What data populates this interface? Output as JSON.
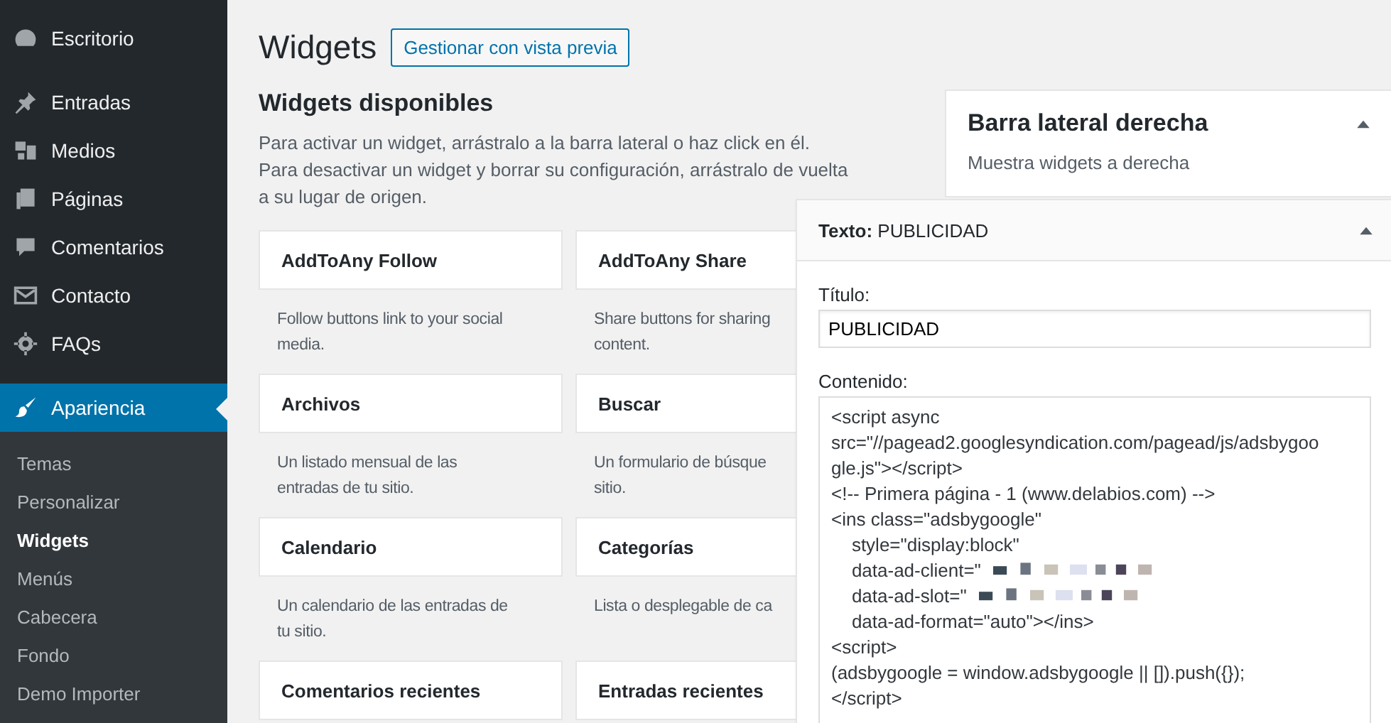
{
  "sidebar": {
    "items": [
      {
        "label": "Escritorio",
        "selected": false
      },
      {
        "label": "Entradas",
        "selected": false
      },
      {
        "label": "Medios",
        "selected": false
      },
      {
        "label": "Páginas",
        "selected": false
      },
      {
        "label": "Comentarios",
        "selected": false
      },
      {
        "label": "Contacto",
        "selected": false
      },
      {
        "label": "FAQs",
        "selected": false
      },
      {
        "label": "Apariencia",
        "selected": true
      }
    ],
    "submenu": [
      {
        "label": "Temas",
        "selected": false
      },
      {
        "label": "Personalizar",
        "selected": false
      },
      {
        "label": "Widgets",
        "selected": true
      },
      {
        "label": "Menús",
        "selected": false
      },
      {
        "label": "Cabecera",
        "selected": false
      },
      {
        "label": "Fondo",
        "selected": false
      },
      {
        "label": "Demo Importer",
        "selected": false
      }
    ]
  },
  "page": {
    "title": "Widgets",
    "button": "Gestionar con vista previa"
  },
  "available": {
    "title": "Widgets disponibles",
    "description": "Para activar un widget, arrástralo a la barra lateral o haz click en él. Para desactivar un widget y borrar su configuración, arrástralo de vuelta a su lugar de origen.",
    "widgets": [
      {
        "title": "AddToAny Follow",
        "description": "Follow buttons link to your social\nmedia."
      },
      {
        "title": "AddToAny Share",
        "description": "Share buttons for sharing\ncontent."
      },
      {
        "title": "Archivos",
        "description": "Un listado mensual de las\nentradas de tu sitio."
      },
      {
        "title": "Buscar",
        "description": "Un formulario de búsque\nsitio."
      },
      {
        "title": "Calendario",
        "description": "Un calendario de las entradas de\ntu sitio."
      },
      {
        "title": "Categorías",
        "description": "Lista o desplegable de ca"
      },
      {
        "title": "Comentarios recientes"
      },
      {
        "title": "Entradas recientes"
      }
    ]
  },
  "sidebar_area": {
    "title": "Barra lateral derecha",
    "description": "Muestra widgets a derecha",
    "expanded": true
  },
  "widget_panel": {
    "title": "**Texto:** PUBLICIDAD",
    "expanded": true,
    "title_label": "Título:",
    "title_value": "PUBLICIDAD",
    "content_label": "Contenido:",
    "content_lines": [
      {
        "text": "<script async",
        "redacted": false
      },
      {
        "text": "src=\"//pagead2.googlesyndication.com/pagead/js/adsbygoo",
        "redacted": false
      },
      {
        "text": "gle.js\"></script>",
        "redacted": false
      },
      {
        "text": "<!-- Primera página - 1 (www.delabios.com) -->",
        "redacted": false
      },
      {
        "text": "<ins class=\"adsbygoogle\"",
        "redacted": false
      },
      {
        "text": "    style=\"display:block\"",
        "redacted": false
      },
      {
        "text": "    data-ad-client=\"",
        "redacted": true
      },
      {
        "text": "    data-ad-slot=\"",
        "redacted": true
      },
      {
        "text": "    data-ad-format=\"auto\"></ins>",
        "redacted": false
      },
      {
        "text": "<script>",
        "redacted": false
      },
      {
        "text": "(adsbygoogle = window.adsbygoogle || []).push({});",
        "redacted": false
      },
      {
        "text": "</script>",
        "redacted": false
      }
    ]
  }
}
